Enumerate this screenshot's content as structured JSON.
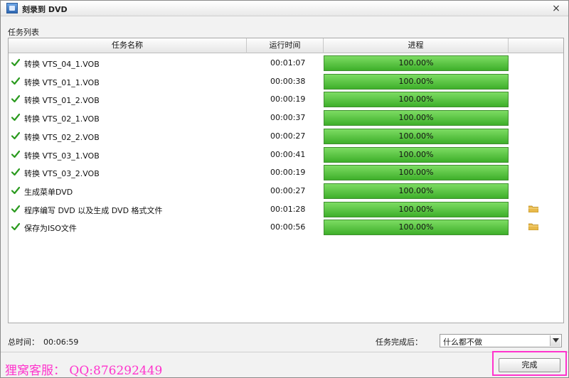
{
  "window": {
    "title": "刻录到 DVD",
    "close_symbol": "×"
  },
  "section_label": "任务列表",
  "table": {
    "columns": [
      "任务名称",
      "运行时间",
      "进程",
      ""
    ],
    "rows": [
      {
        "name": "转换 VTS_04_1.VOB",
        "time": "00:01:07",
        "progress_text": "100.00%",
        "progress": 1.0,
        "folder": false
      },
      {
        "name": "转换 VTS_01_1.VOB",
        "time": "00:00:38",
        "progress_text": "100.00%",
        "progress": 1.0,
        "folder": false
      },
      {
        "name": "转换 VTS_01_2.VOB",
        "time": "00:00:19",
        "progress_text": "100.00%",
        "progress": 1.0,
        "folder": false
      },
      {
        "name": "转换 VTS_02_1.VOB",
        "time": "00:00:37",
        "progress_text": "100.00%",
        "progress": 1.0,
        "folder": false
      },
      {
        "name": "转换 VTS_02_2.VOB",
        "time": "00:00:27",
        "progress_text": "100.00%",
        "progress": 1.0,
        "folder": false
      },
      {
        "name": "转换 VTS_03_1.VOB",
        "time": "00:00:41",
        "progress_text": "100.00%",
        "progress": 1.0,
        "folder": false
      },
      {
        "name": "转换 VTS_03_2.VOB",
        "time": "00:00:19",
        "progress_text": "100.00%",
        "progress": 1.0,
        "folder": false
      },
      {
        "name": "生成菜单DVD",
        "time": "00:00:27",
        "progress_text": "100.00%",
        "progress": 1.0,
        "folder": false
      },
      {
        "name": "程序编写 DVD 以及生成 DVD 格式文件",
        "time": "00:01:28",
        "progress_text": "100.00%",
        "progress": 1.0,
        "folder": true
      },
      {
        "name": "保存为ISO文件",
        "time": "00:00:56",
        "progress_text": "100.00%",
        "progress": 1.0,
        "folder": true
      }
    ]
  },
  "footer": {
    "total_label": "总时间：",
    "total_value": "00:06:59",
    "after_label": "任务完成后：",
    "after_selected": "什么都不做"
  },
  "watermark": "狸窝客服： QQ:876292449",
  "done_button": "完成",
  "icons": {
    "status": "check-icon",
    "folder": "folder-icon",
    "dropdown": "chevron-down-icon",
    "app": "dvd-burn-icon"
  },
  "colors": {
    "progress_fill": "#4cbf35",
    "check": "#2a9a1e",
    "watermark": "#ff33cc",
    "highlight": "#ff33cc"
  }
}
